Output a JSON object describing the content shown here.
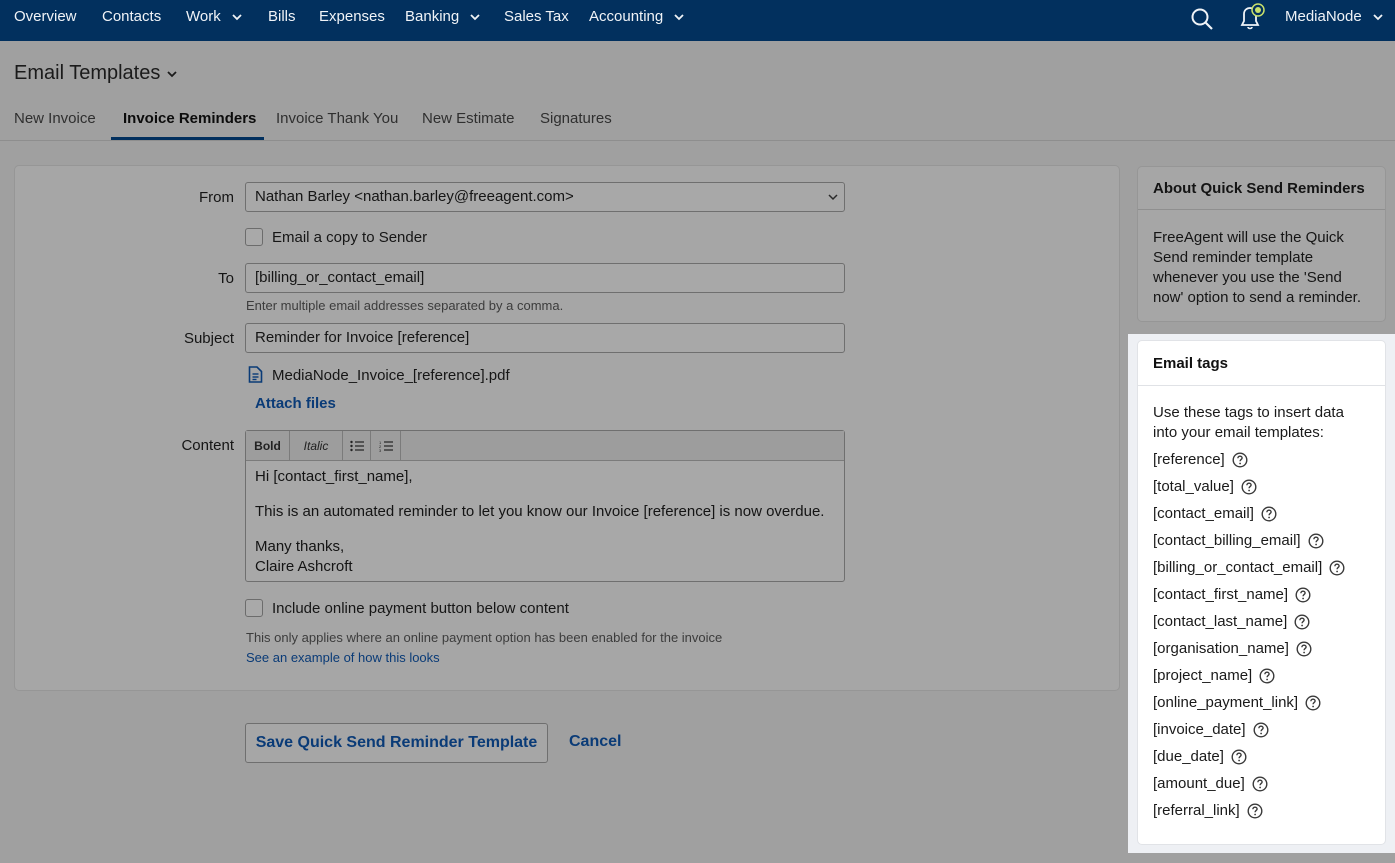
{
  "nav": {
    "items": [
      "Overview",
      "Contacts",
      "Work",
      "Bills",
      "Expenses",
      "Banking",
      "Sales Tax",
      "Accounting"
    ],
    "user": "MediaNode",
    "bg_color": "#02305e"
  },
  "page": {
    "title": "Email Templates",
    "tabs": [
      "New Invoice",
      "Invoice Reminders",
      "Invoice Thank You",
      "New Estimate",
      "Signatures"
    ],
    "active_tab": "Invoice Reminders"
  },
  "form": {
    "from_label": "From",
    "from_value": "Nathan Barley <nathan.barley@freeagent.com>",
    "copy_sender_label": "Email a copy to Sender",
    "to_label": "To",
    "to_value": "[billing_or_contact_email]",
    "to_hint": "Enter multiple email addresses separated by a comma.",
    "subject_label": "Subject",
    "subject_value": "Reminder for Invoice [reference]",
    "attachment_name": "MediaNode_Invoice_[reference].pdf",
    "attach_files": "Attach files",
    "content_label": "Content",
    "toolbar": {
      "bold": "Bold",
      "italic": "Italic"
    },
    "content": {
      "line1": "Hi [contact_first_name],",
      "line2": "This is an automated reminder to let you know our Invoice [reference] is now overdue.",
      "line3": "Many thanks,",
      "line4": "Claire Ashcroft"
    },
    "payment_button_label": "Include online payment button below content",
    "payment_hint": "This only applies where an online payment option has been enabled for the invoice",
    "payment_example_link": "See an example of how this looks",
    "save_button": "Save Quick Send Reminder Template",
    "cancel_button": "Cancel"
  },
  "about": {
    "title": "About Quick Send Reminders",
    "body": "FreeAgent will use the Quick Send reminder template whenever you use the 'Send now' option to send a reminder."
  },
  "email_tags": {
    "title": "Email tags",
    "intro": "Use these tags to insert data into your email templates:",
    "tags": [
      "[reference]",
      "[total_value]",
      "[contact_email]",
      "[contact_billing_email]",
      "[billing_or_contact_email]",
      "[contact_first_name]",
      "[contact_last_name]",
      "[organisation_name]",
      "[project_name]",
      "[online_payment_link]",
      "[invoice_date]",
      "[due_date]",
      "[amount_due]",
      "[referral_link]"
    ]
  }
}
